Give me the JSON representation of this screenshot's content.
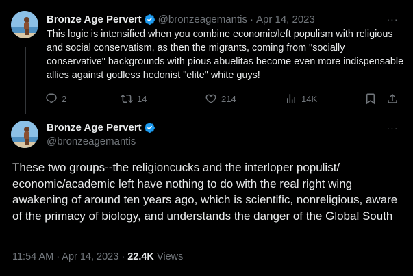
{
  "tweet1": {
    "author_name": "Bronze Age Pervert",
    "handle": "@bronzeagemantis",
    "separator": "·",
    "date": "Apr 14, 2023",
    "more": "···",
    "text": "This logic is intensified when you combine economic/left populism with religious and social conservatism, as then the migrants, coming from \"socially conservative\" backgrounds with pious abuelitas become even more indispensable allies against godless hedonist \"elite\" white guys!",
    "actions": {
      "replies": "2",
      "reposts": "14",
      "likes": "214",
      "views": "14K"
    }
  },
  "tweet2": {
    "author_name": "Bronze Age Pervert",
    "handle": "@bronzeagemantis",
    "more": "···",
    "text": "These two groups--the religioncucks and the interloper populist/ economic/academic left have nothing to do with the real right wing awakening of around ten years ago, which is scientific, nonreligious, aware of the primacy of biology, and understands the danger of the Global South",
    "timestamp": "11:54 AM · Apr 14, 2023 ·",
    "views_count": "22.4K",
    "views_label": "Views"
  },
  "colors": {
    "background": "#000000",
    "text": "#e7e9ea",
    "secondary": "#71767b",
    "verified": "#1d9bf0",
    "thread_line": "#333639"
  },
  "icons": [
    "reply-icon",
    "repost-icon",
    "like-icon",
    "views-icon",
    "bookmark-icon",
    "share-icon",
    "verified-badge-icon"
  ]
}
